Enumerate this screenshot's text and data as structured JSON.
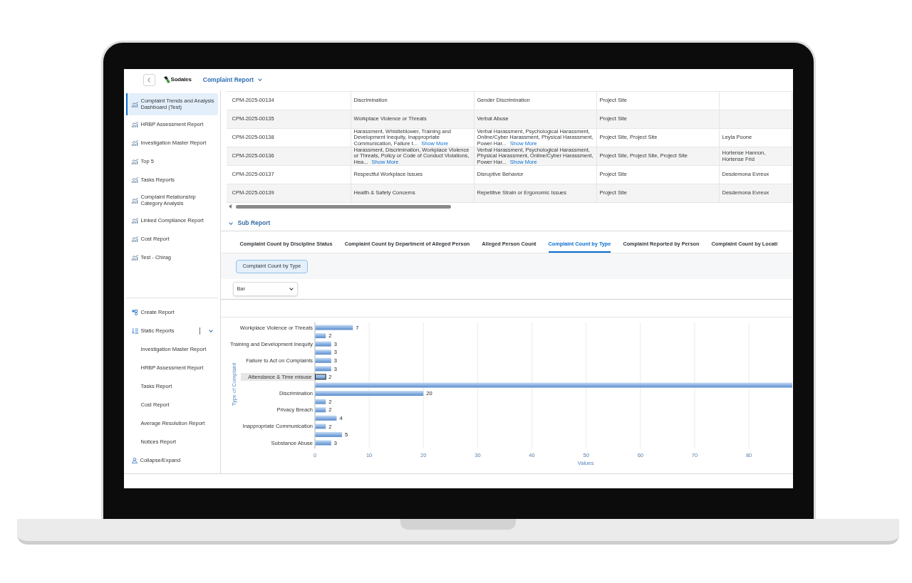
{
  "header": {
    "logo": "Sodales",
    "title": "Complaint Report"
  },
  "sidebar": {
    "reports": [
      {
        "label": "Complaint Trends and Analysis Dashboard (Test)",
        "selected": true
      },
      {
        "label": "HRBP Assessment Report",
        "selected": false
      },
      {
        "label": "Investigation Master Report",
        "selected": false
      },
      {
        "label": "Top 5",
        "selected": false
      },
      {
        "label": "Tasks Reports",
        "selected": false
      },
      {
        "label": "Complaint Relationship Category Analysis",
        "selected": false
      },
      {
        "label": "Linked Compliance Report",
        "selected": false
      },
      {
        "label": "Cost Report",
        "selected": false
      },
      {
        "label": "Test - Chirag",
        "selected": false
      }
    ],
    "actions": [
      {
        "kind": "create",
        "label": "Create Report"
      },
      {
        "kind": "group",
        "label": "Static Reports",
        "expanded": true,
        "children": [
          {
            "label": "Investigation Master Report"
          },
          {
            "label": "HRBP Assessment Report"
          },
          {
            "label": "Tasks Report"
          },
          {
            "label": "Cost Report"
          },
          {
            "label": "Average Resolution Report"
          },
          {
            "label": "Notices Report"
          }
        ]
      },
      {
        "kind": "toggle",
        "label": "Collapse/Expand"
      }
    ]
  },
  "table": {
    "rows": [
      {
        "cells": [
          {
            "text": "CPM-2025-00134"
          },
          {
            "text": "Discrimination"
          },
          {
            "text": "Gender Discrimination"
          },
          {
            "text": "Project Site"
          }
        ]
      },
      {
        "cells": [
          {
            "text": "CPM-2025-00135"
          },
          {
            "text": "Workplace Violence or Threats"
          },
          {
            "text": "Verbal Abuse"
          },
          {
            "text": "Project Site"
          }
        ]
      },
      {
        "cells": [
          {
            "text": "CPM-2025-00138"
          },
          {
            "text": "Harassment, Whistleblower, Training and Development Inequity, Inappropriate Communication, Failure t...",
            "link": "Show More"
          },
          {
            "text": "Verbal Harassment, Psychological Harassment, Online/Cyber Harassment, Physical Harassment, Power Har...",
            "link": "Show More"
          },
          {
            "text": "Project Site, Project Site"
          },
          {
            "text": "Leyla Poone"
          }
        ]
      },
      {
        "cells": [
          {
            "text": "CPM-2025-00136"
          },
          {
            "text": "Harassment, Discrimination, Workplace Violence or Threats, Policy or Code of Conduct Violations, Hea...",
            "link": "Show More"
          },
          {
            "text": "Verbal Harassment, Psychological Harassment, Physical Harassment, Online/Cyber Harassment, Power Har...",
            "link": "Show More"
          },
          {
            "text": "Project Site, Project Site, Project Site"
          },
          {
            "text": "Hortense Hannon, Hortense Frid"
          }
        ]
      },
      {
        "cells": [
          {
            "text": "CPM-2025-00137"
          },
          {
            "text": "Respectful Workplace Issues"
          },
          {
            "text": "Disruptive Behavior"
          },
          {
            "text": "Project Site"
          },
          {
            "text": "Desdemona Evreux"
          }
        ]
      },
      {
        "cells": [
          {
            "text": "CPM-2025-00139"
          },
          {
            "text": "Health & Safety Concerns"
          },
          {
            "text": "Repetitive Strain or Ergonomic Issues"
          },
          {
            "text": "Project Site"
          },
          {
            "text": "Desdemona Evreux"
          }
        ]
      }
    ]
  },
  "sub_report": {
    "title": "Sub Report",
    "expanded": true,
    "tabs": [
      {
        "label": "Complaint Count by Discipline Status",
        "selected": false
      },
      {
        "label": "Complaint Count by Department of Alleged Person",
        "selected": false
      },
      {
        "label": "Alleged Person Count",
        "selected": false
      },
      {
        "label": "Complaint Count by Type",
        "selected": true
      },
      {
        "label": "Complaint Reported by Person",
        "selected": false
      },
      {
        "label": "Complaint Count by Locati",
        "selected": false
      }
    ],
    "chip": "Complaint Count by Type",
    "chart_type": {
      "value": "Bar"
    },
    "chart": {
      "chart_data": {
        "type": "bar",
        "orientation": "horizontal",
        "xlabel": "Values",
        "ylabel": "Type of Complaint",
        "categories": [
          "Workplace Violence or Threats",
          null,
          "Training and Development Inequity",
          null,
          "Failure to Act on Complaints",
          null,
          "Attendance & Time misuse",
          null,
          "Discrimination",
          null,
          "Privacy Breach",
          null,
          "Inappropriate Communication",
          null,
          "Substance Abuse"
        ],
        "values": [
          7,
          2,
          3,
          3,
          3,
          3,
          2,
          88,
          20,
          2,
          2,
          4,
          2,
          5,
          3
        ],
        "xlim": [
          0,
          88
        ],
        "xticks": [
          0,
          10,
          20,
          30,
          40,
          50,
          60,
          70,
          80
        ],
        "grid": true,
        "value_labels": [
          "7",
          "2",
          "3",
          "3",
          "3",
          "3",
          "2",
          null,
          "20",
          "2",
          "2",
          "4",
          "2",
          "5",
          "3"
        ]
      },
      "bar_states": [
        {
          "selected": false
        },
        {
          "selected": false
        },
        {
          "selected": false
        },
        {
          "selected": false
        },
        {
          "selected": false
        },
        {
          "selected": false
        },
        {
          "selected": true
        },
        {
          "selected": false
        },
        {
          "selected": false
        },
        {
          "selected": false
        },
        {
          "selected": false
        },
        {
          "selected": false
        },
        {
          "selected": false
        },
        {
          "selected": false
        },
        {
          "selected": false
        }
      ]
    }
  }
}
